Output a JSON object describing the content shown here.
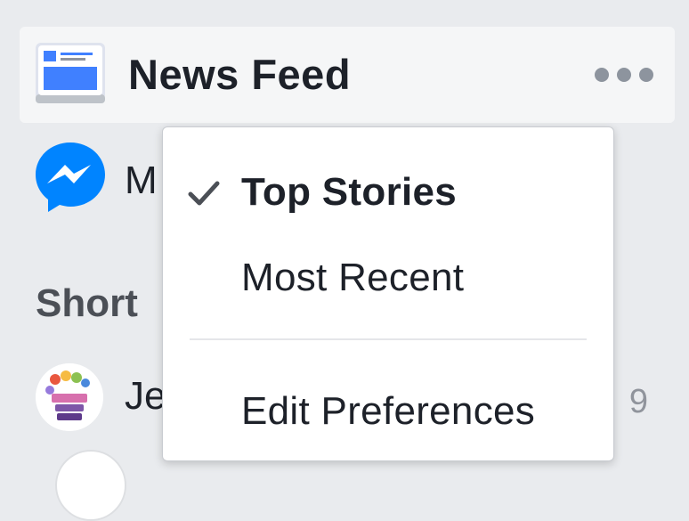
{
  "sidebar": {
    "news_feed": {
      "label": "News Feed",
      "icon": "newsfeed-icon",
      "more_icon": "more-options-icon"
    },
    "messenger": {
      "label_visible": "M",
      "icon": "messenger-icon"
    },
    "shortcuts": {
      "title_visible": "Short",
      "items": [
        {
          "label_visible": "Je",
          "count_visible": "9",
          "icon": "group-avatar"
        }
      ]
    }
  },
  "dropdown": {
    "items": [
      {
        "label": "Top Stories",
        "selected": true,
        "icon": "checkmark-icon"
      },
      {
        "label": "Most Recent",
        "selected": false
      }
    ],
    "footer_item": {
      "label": "Edit Preferences"
    }
  },
  "colors": {
    "background": "#e9ebee",
    "messenger_blue": "#0084ff",
    "newsfeed_blue": "#4080ff",
    "text_primary": "#1d2129",
    "text_secondary": "#4b4f56"
  }
}
